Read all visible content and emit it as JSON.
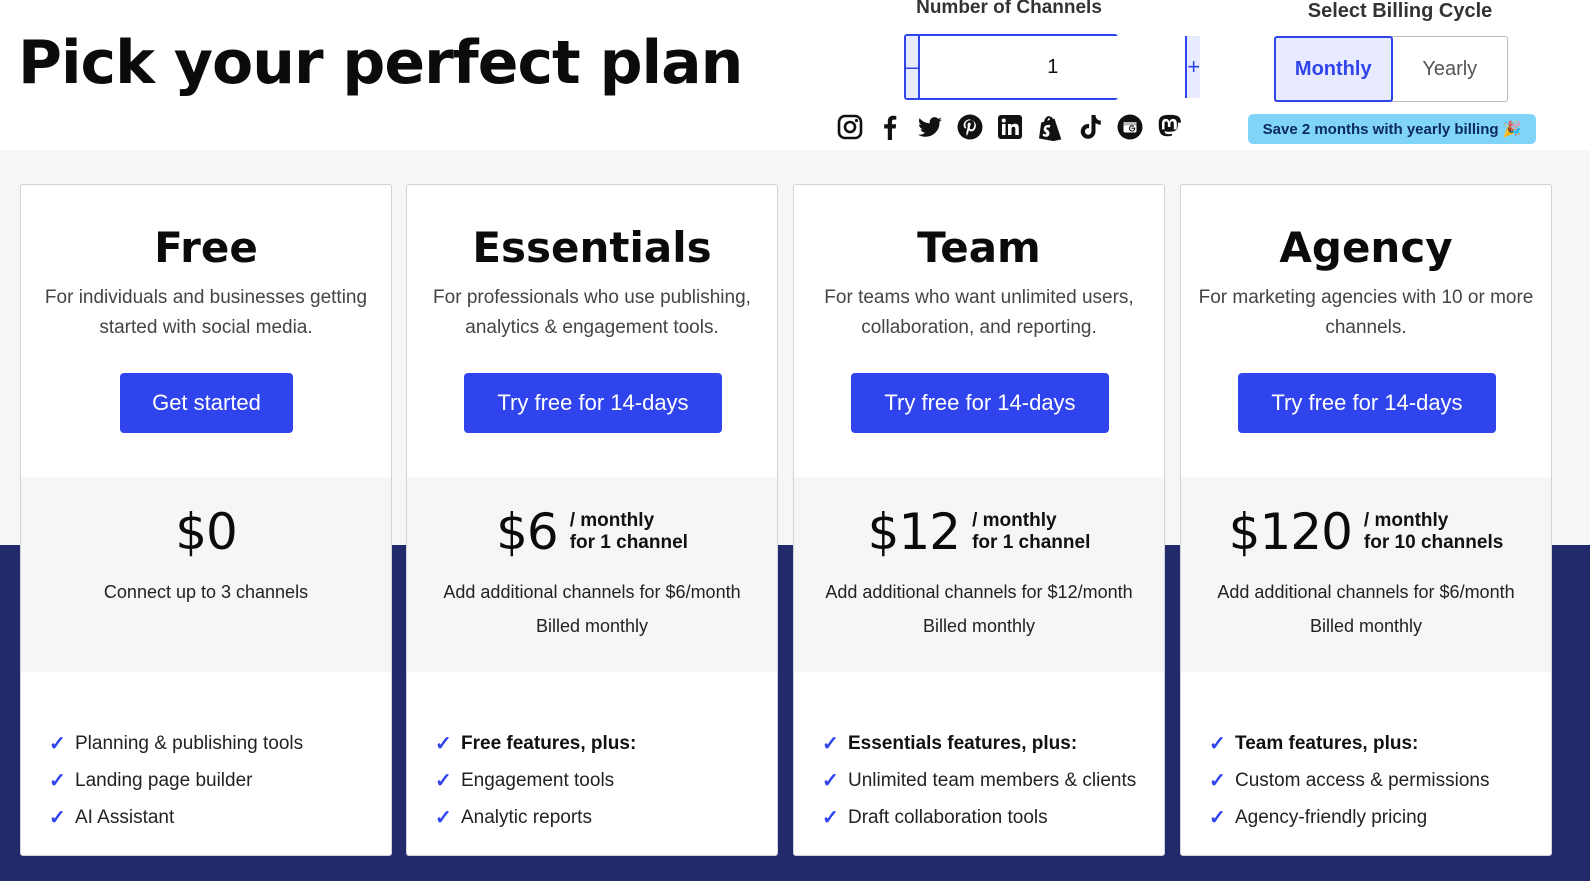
{
  "header": {
    "title": "Pick your perfect plan"
  },
  "channels": {
    "label": "Number of Channels",
    "minus": "–",
    "value": "1",
    "plus": "+",
    "social_icons": [
      "instagram-icon",
      "facebook-icon",
      "twitter-icon",
      "pinterest-icon",
      "linkedin-icon",
      "shopify-icon",
      "tiktok-icon",
      "google-business-icon",
      "mastodon-icon"
    ]
  },
  "billing": {
    "label": "Select Billing Cycle",
    "monthly": "Monthly",
    "yearly": "Yearly",
    "selected": "Monthly",
    "badge": "Save 2 months with yearly billing 🎉"
  },
  "colors": {
    "accent": "#2f44ec",
    "dark_band": "#222a6b",
    "badge": "#7fd4f8"
  },
  "plans": [
    {
      "name": "Free",
      "description": "For individuals and businesses getting started with social media.",
      "cta": "Get started",
      "price": "$0",
      "unit_line1": "",
      "unit_line2": "",
      "note1": "Connect up to 3 channels",
      "note2": "",
      "features": [
        "Planning & publishing tools",
        "Landing page builder",
        "AI Assistant"
      ]
    },
    {
      "name": "Essentials",
      "description": "For professionals who use publishing, analytics & engagement tools.",
      "cta": "Try free for 14-days",
      "price": "$6",
      "unit_line1": "/ monthly",
      "unit_line2": "for 1 channel",
      "note1": "Add additional channels for $6/month",
      "note2": "Billed monthly",
      "features": [
        "Free features, plus:",
        "Engagement tools",
        "Analytic reports"
      ]
    },
    {
      "name": "Team",
      "description": "For teams who want unlimited users, collaboration, and reporting.",
      "cta": "Try free for 14-days",
      "price": "$12",
      "unit_line1": "/ monthly",
      "unit_line2": "for 1 channel",
      "note1": "Add additional channels for $12/month",
      "note2": "Billed monthly",
      "features": [
        "Essentials features, plus:",
        "Unlimited team members & clients",
        "Draft collaboration tools"
      ]
    },
    {
      "name": "Agency",
      "description": "For marketing agencies with 10 or more channels.",
      "cta": "Try free for 14-days",
      "price": "$120",
      "unit_line1": "/ monthly",
      "unit_line2": "for 10 channels",
      "note1": "Add additional channels for $6/month",
      "note2": "Billed monthly",
      "features": [
        "Team features, plus:",
        "Custom access & permissions",
        "Agency-friendly pricing"
      ]
    }
  ]
}
